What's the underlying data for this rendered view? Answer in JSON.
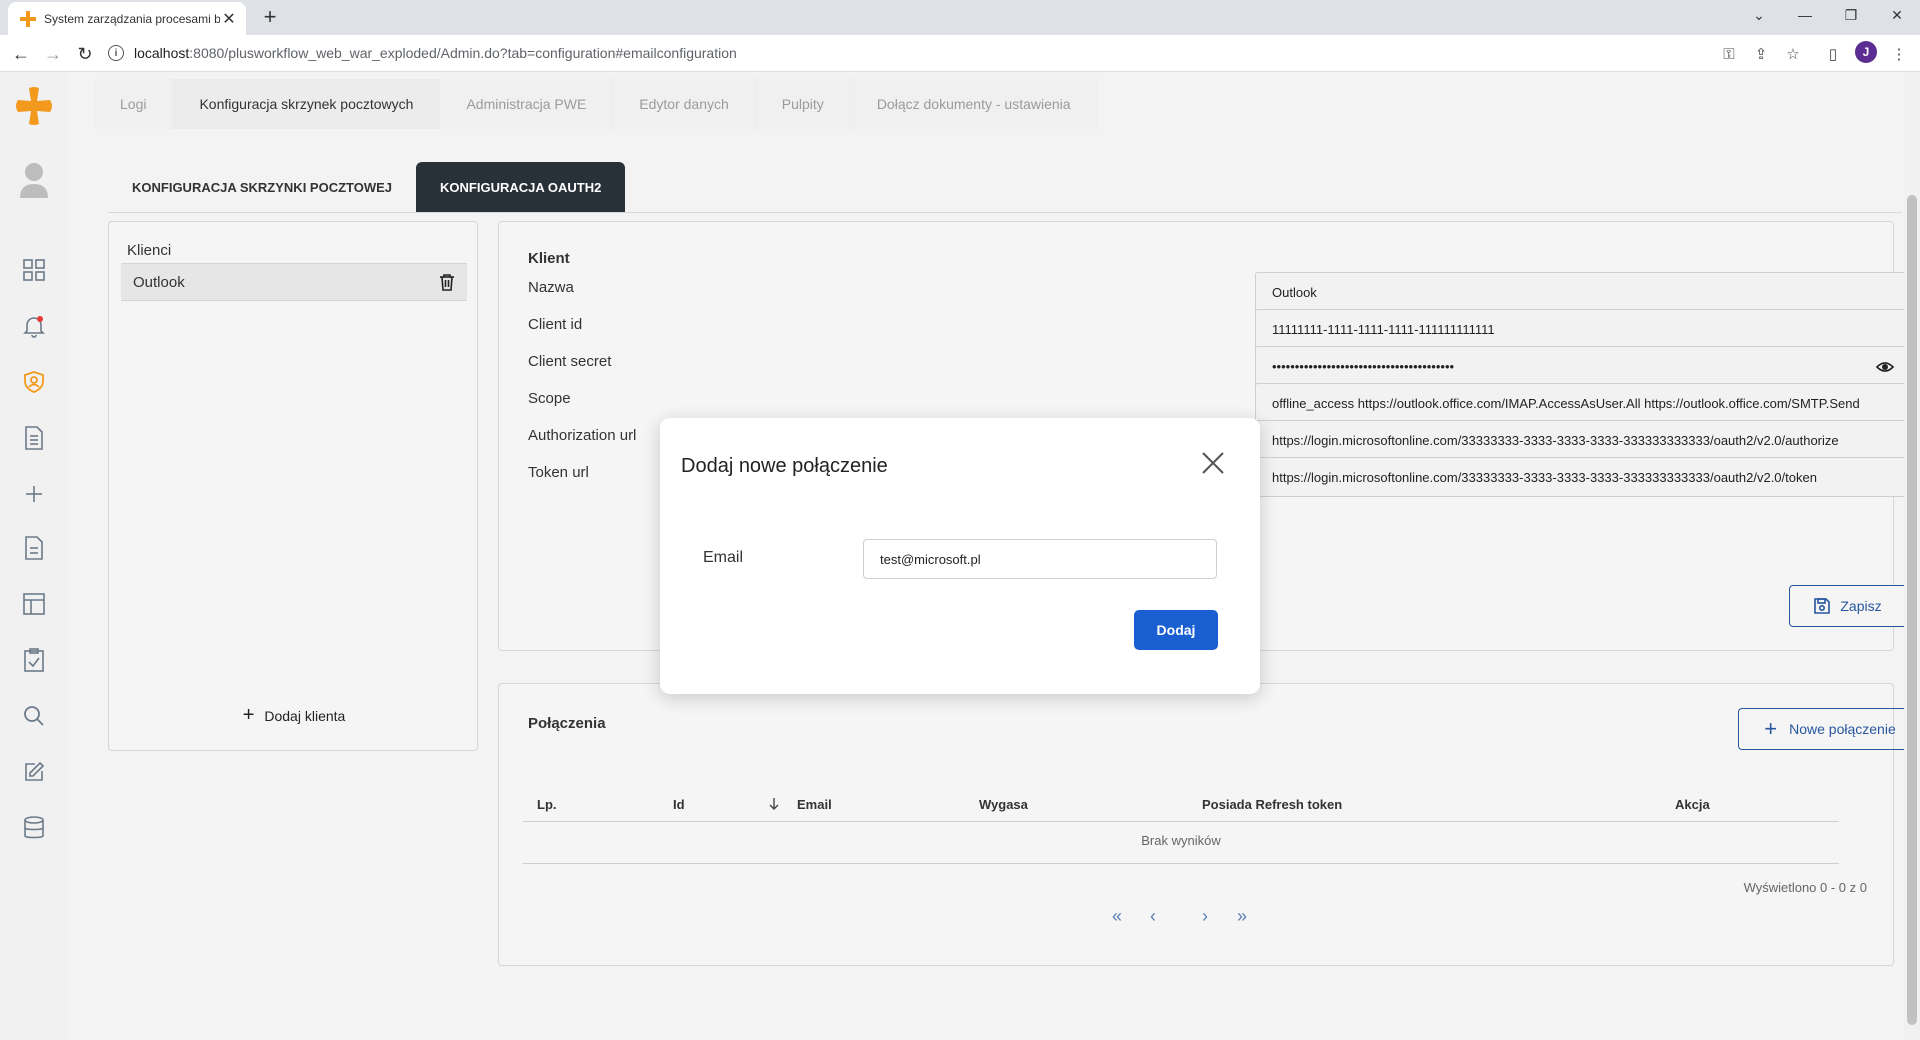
{
  "browser": {
    "tab_title": "System zarządzania procesami bi",
    "url_host": "localhost",
    "url_path": ":8080/plusworkflow_web_war_exploded/Admin.do?tab=configuration#emailconfiguration",
    "profile_initial": "J"
  },
  "topnav": {
    "items": [
      {
        "label": "Logi"
      },
      {
        "label": "Konfiguracja skrzynek pocztowych"
      },
      {
        "label": "Administracja PWE"
      },
      {
        "label": "Edytor danych"
      },
      {
        "label": "Pulpity"
      },
      {
        "label": "Dołącz dokumenty - ustawienia"
      }
    ],
    "active": "Konfiguracja skrzynek pocztowych"
  },
  "subtabs": {
    "mailbox": "KONFIGURACJA SKRZYNKI POCZTOWEJ",
    "oauth2": "KONFIGURACJA OAUTH2"
  },
  "clients": {
    "header": "Klienci",
    "items": [
      {
        "name": "Outlook"
      }
    ],
    "add_label": "Dodaj klienta"
  },
  "client_form": {
    "title": "Klient",
    "fields": [
      {
        "label": "Nazwa",
        "value": "Outlook"
      },
      {
        "label": "Client id",
        "value": "11111111-1111-1111-1111-111111111111"
      },
      {
        "label": "Client secret",
        "value": "••••••••••••••••••••••••••••••••••••••••"
      },
      {
        "label": "Scope",
        "value": "offline_access https://outlook.office.com/IMAP.AccessAsUser.All https://outlook.office.com/SMTP.Send"
      },
      {
        "label": "Authorization url",
        "value": "https://login.microsoftonline.com/33333333-3333-3333-3333-333333333333/oauth2/v2.0/authorize"
      },
      {
        "label": "Token url",
        "value": "https://login.microsoftonline.com/33333333-3333-3333-3333-333333333333/oauth2/v2.0/token"
      }
    ],
    "save_label": "Zapisz"
  },
  "connections": {
    "title": "Połączenia",
    "new_label": "Nowe połączenie",
    "columns": [
      "Lp.",
      "Id",
      "Email",
      "Wygasa",
      "Posiada Refresh token",
      "Akcja"
    ],
    "empty_text": "Brak wyników",
    "shown_text": "Wyświetlono 0 - 0 z 0",
    "pager": [
      "«",
      "‹",
      "›",
      "»"
    ]
  },
  "modal": {
    "title": "Dodaj nowe połączenie",
    "email_label": "Email",
    "email_value": "test@microsoft.pl",
    "submit_label": "Dodaj"
  },
  "colors": {
    "accent_blue": "#26579e",
    "primary_button": "#1a5fd1",
    "active_subtab": "#283038",
    "logo_orange": "#f39a1e"
  }
}
